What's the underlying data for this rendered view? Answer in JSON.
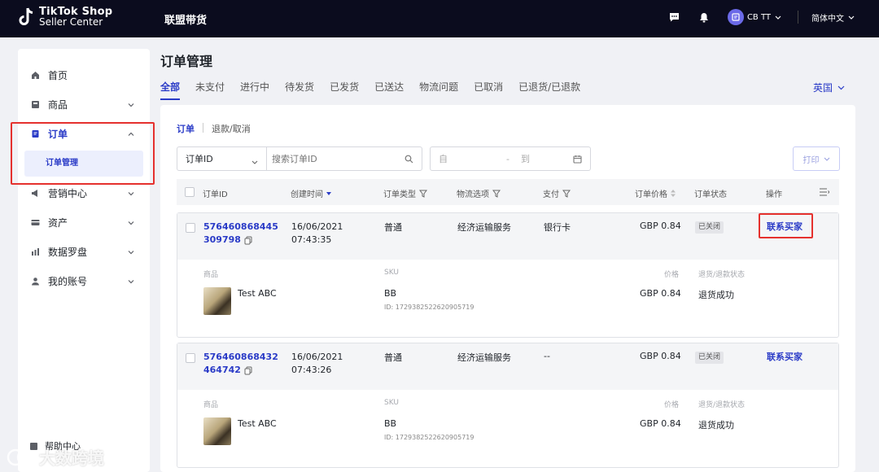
{
  "header": {
    "logo_line1": "TikTok Shop",
    "logo_line2": "Seller Center",
    "nav_title": "联盟带货",
    "account_name": "CB TT",
    "language": "简体中文"
  },
  "sidebar": {
    "items": [
      {
        "label": "首页",
        "icon": "home-icon"
      },
      {
        "label": "商品",
        "icon": "product-icon"
      },
      {
        "label": "订单",
        "icon": "order-icon"
      },
      {
        "label": "营销中心",
        "icon": "megaphone-icon"
      },
      {
        "label": "资产",
        "icon": "card-icon"
      },
      {
        "label": "数据罗盘",
        "icon": "chart-icon"
      },
      {
        "label": "我的账号",
        "icon": "user-icon"
      }
    ],
    "sub_item": "订单管理",
    "help": "帮助中心"
  },
  "page": {
    "title": "订单管理",
    "status_tabs": [
      "全部",
      "未支付",
      "进行中",
      "待发货",
      "已发货",
      "已送达",
      "物流问题",
      "已取消",
      "已退货/已退款"
    ],
    "region": "英国"
  },
  "card": {
    "sub_tabs": [
      "订单",
      "退款/取消"
    ],
    "search_select": "订单ID",
    "search_placeholder": "搜索订单ID",
    "date_from": "自",
    "date_sep": "-",
    "date_to": "到",
    "print_label": "打印"
  },
  "table": {
    "headers": [
      "订单ID",
      "创建时间",
      "订单类型",
      "物流选项",
      "支付",
      "订单价格",
      "订单状态",
      "操作"
    ],
    "detail_labels": {
      "product": "商品",
      "sku": "SKU",
      "price": "价格",
      "refund_status": "退货/退款状态"
    },
    "orders": [
      {
        "id_line1": "576460868445",
        "id_line2": "309798",
        "date": "16/06/2021",
        "time": "07:43:35",
        "type": "普通",
        "logistics": "经济运输服务",
        "payment": "银行卡",
        "price": "GBP 0.84",
        "status": "已关闭",
        "action": "联系买家",
        "product_name": "Test ABC",
        "sku": "BB",
        "sku_id": "ID: 1729382522620905719",
        "item_price": "GBP 0.84",
        "refund_status": "退货成功"
      },
      {
        "id_line1": "576460868432",
        "id_line2": "464742",
        "date": "16/06/2021",
        "time": "07:43:26",
        "type": "普通",
        "logistics": "经济运输服务",
        "payment": "--",
        "price": "GBP 0.84",
        "status": "已关闭",
        "action": "联系买家",
        "product_name": "Test ABC",
        "sku": "BB",
        "sku_id": "ID: 1729382522620905719",
        "item_price": "GBP 0.84",
        "refund_status": "退货成功"
      }
    ]
  },
  "watermark": "大数跨境",
  "colors": {
    "brand": "#2a3bc7",
    "topbar": "#0b0c1e",
    "highlight": "#e5312e"
  }
}
